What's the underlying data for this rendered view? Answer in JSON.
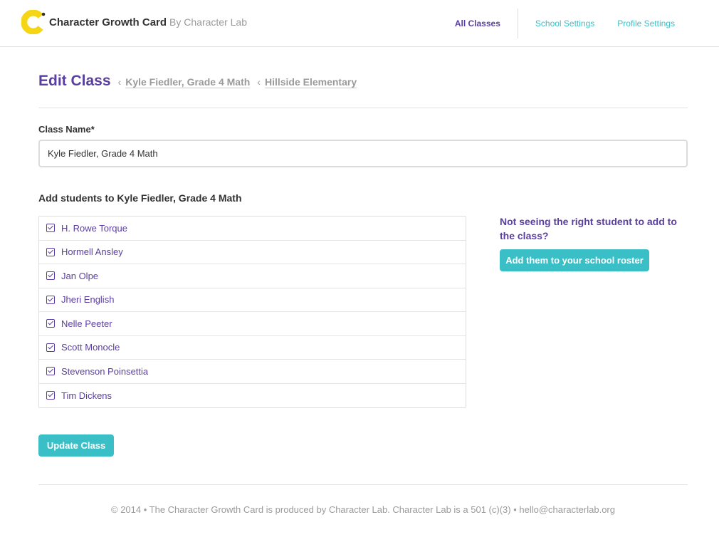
{
  "header": {
    "brand_name": "Character Growth Card",
    "brand_by": "By Character Lab",
    "nav": [
      {
        "label": "All Classes"
      },
      {
        "label": "School Settings"
      },
      {
        "label": "Profile Settings"
      }
    ]
  },
  "title_bar": {
    "title": "Edit Class",
    "separator": "‹",
    "breadcrumbs": [
      {
        "label": "Kyle Fiedler, Grade 4 Math"
      },
      {
        "label": "Hillside Elementary"
      }
    ]
  },
  "form": {
    "class_name_label": "Class Name*",
    "class_name_value": "Kyle Fiedler, Grade 4 Math",
    "students_heading": "Add students to Kyle Fiedler, Grade 4 Math",
    "students": [
      {
        "name": "H. Rowe Torque",
        "checked": true
      },
      {
        "name": "Hormell Ansley",
        "checked": true
      },
      {
        "name": "Jan Olpe",
        "checked": true
      },
      {
        "name": "Jheri English",
        "checked": true
      },
      {
        "name": "Nelle Peeter",
        "checked": true
      },
      {
        "name": "Scott Monocle",
        "checked": true
      },
      {
        "name": "Stevenson Poinsettia",
        "checked": true
      },
      {
        "name": "Tim Dickens",
        "checked": true
      }
    ],
    "update_button": "Update Class"
  },
  "aside": {
    "prompt": "Not seeing the right student to add to the class?",
    "roster_button": "Add them to your school roster"
  },
  "footer": {
    "text": "© 2014 • The Character Growth Card is produced by Character Lab. Character Lab is a 501 (c)(3) • hello@characterlab.org"
  },
  "colors": {
    "primary_purple": "#5b3fa0",
    "accent_teal": "#3bbfc6",
    "logo_yellow": "#f5d516",
    "muted_gray": "#9a9a9a"
  }
}
